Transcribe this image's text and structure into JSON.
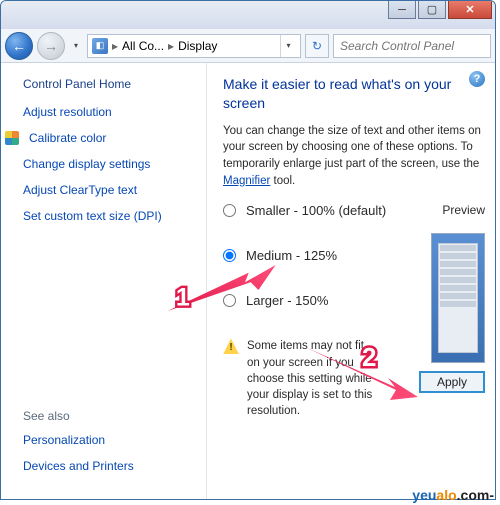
{
  "nav": {
    "crumb1": "All Co...",
    "crumb2": "Display",
    "search_placeholder": "Search Control Panel"
  },
  "sidebar": {
    "home": "Control Panel Home",
    "links": [
      "Adjust resolution",
      "Calibrate color",
      "Change display settings",
      "Adjust ClearType text",
      "Set custom text size (DPI)"
    ],
    "seealso_hdr": "See also",
    "seealso": [
      "Personalization",
      "Devices and Printers"
    ]
  },
  "main": {
    "title": "Make it easier to read what's on your screen",
    "desc_before": "You can change the size of text and other items on your screen by choosing one of these options. To temporarily enlarge just part of the screen, use the ",
    "magnifier": "Magnifier",
    "desc_after": " tool.",
    "options": [
      "Smaller - 100% (default)",
      "Medium - 125%",
      "Larger - 150%"
    ],
    "preview_label": "Preview",
    "warning": "Some items may not fit on your screen if you choose this setting while your display is set to this resolution.",
    "apply": "Apply"
  },
  "annotation": {
    "n1": "1",
    "n2": "2"
  },
  "watermark": {
    "a": "yeu",
    "b": "alo",
    "c": ".com-"
  }
}
